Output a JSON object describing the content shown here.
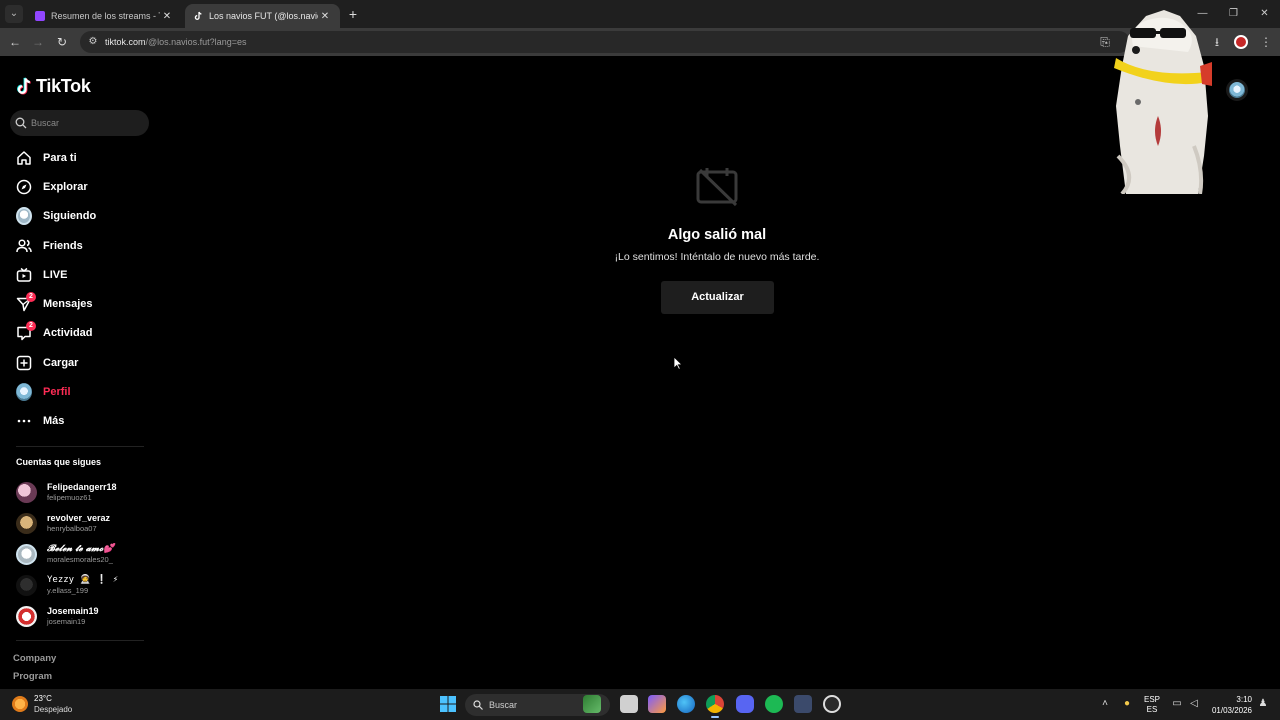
{
  "browser": {
    "tabs": [
      {
        "title": "Resumen de los streams - Twitch",
        "active": false,
        "favicon_color": "#9146ff"
      },
      {
        "title": "Los navios FUT (@los.navios.fut)",
        "active": true,
        "favicon_color": "#000000"
      }
    ],
    "url_host": "tiktok.com",
    "url_path": "/@los.navios.fut?lang=es",
    "new_tab_icon": "plus-icon"
  },
  "tiktok": {
    "logo_text": "TikTok",
    "search_placeholder": "Buscar",
    "nav": [
      {
        "label": "Para ti",
        "icon": "home-icon"
      },
      {
        "label": "Explorar",
        "icon": "compass-icon"
      },
      {
        "label": "Siguiendo",
        "icon": "avatar-icon"
      },
      {
        "label": "Friends",
        "icon": "friends-icon"
      },
      {
        "label": "LIVE",
        "icon": "live-icon"
      },
      {
        "label": "Mensajes",
        "icon": "messages-icon",
        "badge": "2"
      },
      {
        "label": "Actividad",
        "icon": "activity-icon",
        "badge": "2"
      },
      {
        "label": "Cargar",
        "icon": "upload-icon"
      },
      {
        "label": "Perfil",
        "icon": "profile-avatar-icon"
      },
      {
        "label": "Más",
        "icon": "more-icon"
      }
    ],
    "following_title": "Cuentas que sigues",
    "following": [
      {
        "name": "Felipedangerr18",
        "username": "felipemuoz61"
      },
      {
        "name": "revolver_veraz",
        "username": "henrybalboa07"
      },
      {
        "name": "𝓑𝓮𝓵𝓮𝓷 𝓽𝓮 𝓪𝓶𝓸💕",
        "username": "moralesmorales20_"
      },
      {
        "name": "Yezzy 🧑‍🚀 ❕ ⚡",
        "username": "y.ellass_199"
      },
      {
        "name": "Josemain19",
        "username": "josemain19"
      }
    ],
    "footer_links": [
      "Company",
      "Program"
    ],
    "error": {
      "title": "Algo salió mal",
      "message": "¡Lo sentimos! Inténtalo de nuevo más tarde.",
      "button": "Actualizar",
      "icon": "calendar-off-icon"
    },
    "accent_color": "#fe2c55"
  },
  "taskbar": {
    "weather_temp": "23°C",
    "weather_desc": "Despejado",
    "search_label": "Buscar",
    "lang_top": "ESP",
    "lang_bottom": "ES",
    "time": "3:10",
    "date": "01/03/2026"
  }
}
